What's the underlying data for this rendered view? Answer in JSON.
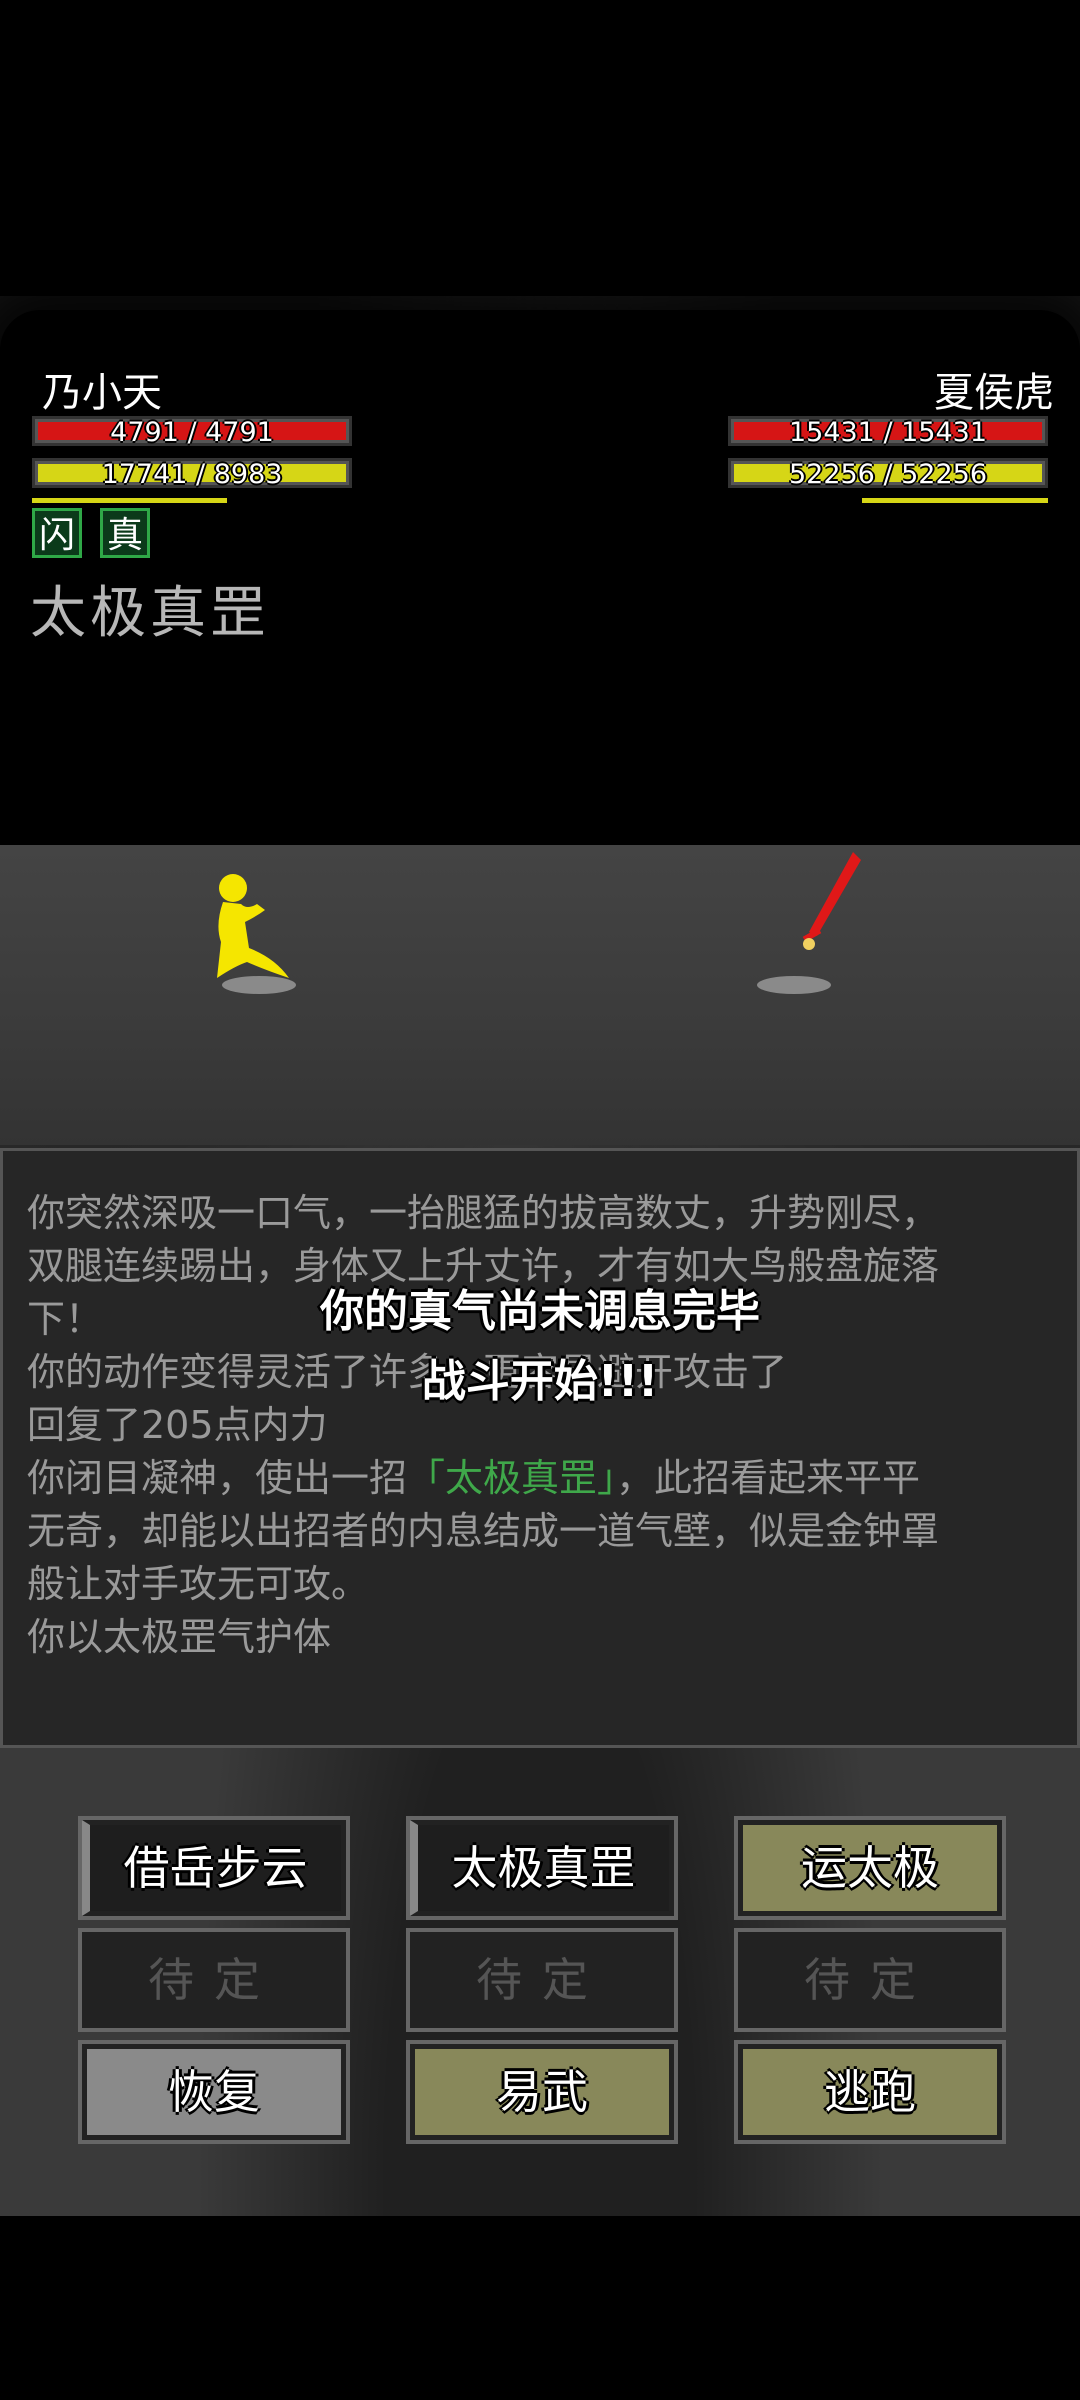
{
  "player": {
    "name": "乃小天",
    "hp_text": "4791 / 4791",
    "hp_ratio": 1.0,
    "mp_text": "17741 / 8983",
    "mp_ratio": 1.0,
    "status_icons": [
      "闪",
      "真"
    ],
    "active_skill": "太极真罡"
  },
  "enemy": {
    "name": "夏侯虎",
    "hp_text": "15431 / 15431",
    "hp_ratio": 1.0,
    "mp_text": "52256 / 52256",
    "mp_ratio": 1.0
  },
  "log": {
    "line1": "你突然深吸一口气，一抬腿猛的拔高数丈，升势刚尽，",
    "line2": "双腿连续踢出，身体又上升丈许，才有如大鸟般盘旋落",
    "line3": "下！",
    "line4": "你的动作变得灵活了许多，更容易避开攻击了",
    "line5": "回复了205点内力",
    "line6_pre": "你闭目凝神，使出一招",
    "line6_hl": "「太极真罡」",
    "line6_post": "，此招看起来平平",
    "line7": "无奇，却能以出招者的内息结成一道气壁，似是金钟罩",
    "line8": "般让对手攻无可攻。",
    "line9": "你以太极罡气护体"
  },
  "overlay": {
    "msg1": "你的真气尚未调息完毕",
    "msg2": "战斗开始!!!"
  },
  "buttons": {
    "b1": "借岳步云",
    "b2": "太极真罡",
    "b3": "运太极",
    "b4": "待定",
    "b5": "待定",
    "b6": "待定",
    "b7": "恢复",
    "b8": "易武",
    "b9": "逃跑"
  },
  "colors": {
    "hp": "#d61515",
    "mp": "#d6d616",
    "player_sprite": "#f5e600",
    "enemy_weapon": "#e01818",
    "log_highlight": "#3fa84a"
  }
}
